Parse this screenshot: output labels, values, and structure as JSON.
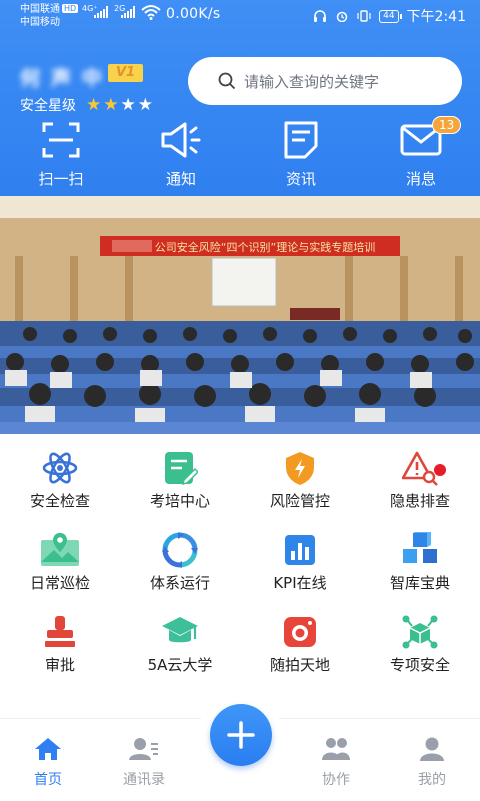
{
  "status_bar": {
    "carrier1": "中国联通",
    "carrier2": "中国移动",
    "hd_badge": "HD",
    "net_type1": "4G⁺",
    "net_type2": "2G",
    "speed": "0.00K/s",
    "battery": "44",
    "time": "下午2:41"
  },
  "header": {
    "username": "何 声 中",
    "vip_level": "V1",
    "safety_label": "安全星级",
    "stars_filled": 2,
    "stars_total": 4,
    "search_placeholder": "请输入查询的关键字"
  },
  "quick_actions": [
    {
      "label": "扫一扫",
      "icon": "scan-icon"
    },
    {
      "label": "通知",
      "icon": "speaker-icon"
    },
    {
      "label": "资讯",
      "icon": "news-icon"
    },
    {
      "label": "消息",
      "icon": "mail-icon",
      "badge": "13"
    }
  ],
  "banner": {
    "text": "公司安全风险“四个识别”理论与实践专题培训"
  },
  "grid": [
    {
      "label": "安全检查",
      "icon": "atom-icon"
    },
    {
      "label": "考培中心",
      "icon": "exam-icon"
    },
    {
      "label": "风险管控",
      "icon": "risk-shield-icon"
    },
    {
      "label": "隐患排查",
      "icon": "warning-search-icon"
    },
    {
      "label": "日常巡检",
      "icon": "map-icon"
    },
    {
      "label": "体系运行",
      "icon": "cycle-icon"
    },
    {
      "label": "KPI在线",
      "icon": "bar-chart-icon"
    },
    {
      "label": "智库宝典",
      "icon": "cubes-icon"
    },
    {
      "label": "审批",
      "icon": "stamp-icon"
    },
    {
      "label": "5A云大学",
      "icon": "graduation-cap-icon"
    },
    {
      "label": "随拍天地",
      "icon": "camera-icon"
    },
    {
      "label": "专项安全",
      "icon": "network-cube-icon"
    }
  ],
  "tabbar": [
    {
      "label": "首页",
      "icon": "home-icon",
      "active": true
    },
    {
      "label": "通讯录",
      "icon": "contacts-icon"
    },
    {
      "label": "",
      "icon": "add-icon"
    },
    {
      "label": "协作",
      "icon": "team-icon"
    },
    {
      "label": "我的",
      "icon": "user-icon"
    }
  ],
  "colors": {
    "primary": "#2F7FF0",
    "badge_orange": "#F5A53A",
    "vip_yellow": "#F7D24A",
    "star_yellow": "#F7C932",
    "icon_blue": "#3A73D8",
    "icon_green": "#3CBF8E",
    "icon_orange": "#F39A22",
    "icon_red": "#E0463A"
  }
}
